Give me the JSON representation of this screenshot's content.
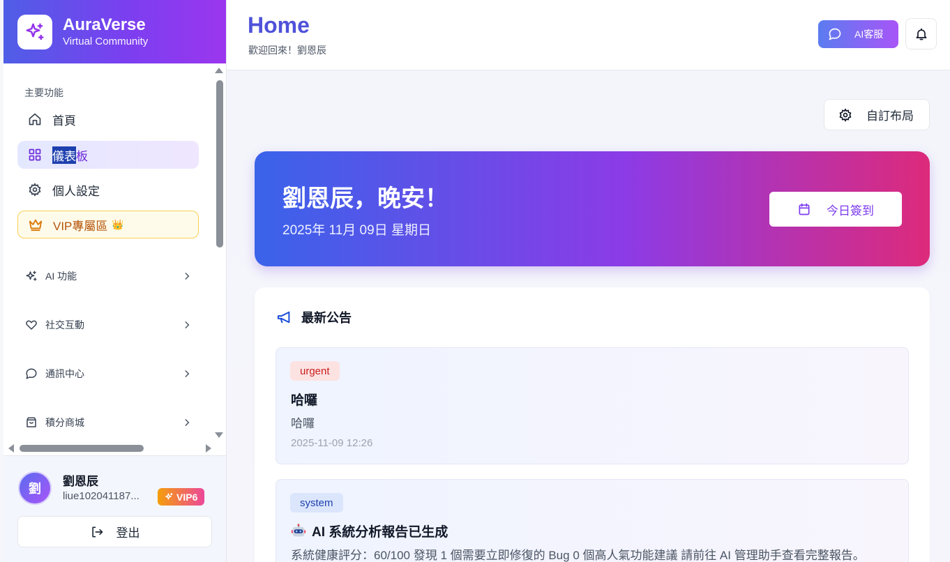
{
  "brand": {
    "name": "AuraVerse",
    "subtitle": "Virtual Community"
  },
  "sidebar": {
    "section_label": "主要功能",
    "items": [
      {
        "label": "首頁",
        "icon": "home-icon"
      },
      {
        "label_selected": "儀表",
        "label_rest": "板",
        "icon": "dashboard-icon",
        "active": true
      },
      {
        "label": "個人設定",
        "icon": "gear-icon"
      },
      {
        "label": "VIP專屬區",
        "icon": "crown-icon",
        "badge": "👑"
      }
    ],
    "groups": [
      {
        "label": "AI 功能",
        "icon": "sparkles-icon"
      },
      {
        "label": "社交互動",
        "icon": "heart-icon"
      },
      {
        "label": "通訊中心",
        "icon": "chat-icon"
      },
      {
        "label": "積分商城",
        "icon": "shopping-bag-icon"
      }
    ]
  },
  "user": {
    "avatar_initial": "劉",
    "name": "劉恩辰",
    "id": "liue102041187...",
    "vip_label": "VIP6",
    "logout_label": "登出"
  },
  "header": {
    "title": "Home",
    "subtitle": "歡迎回來！劉恩辰",
    "ai_service_label": "AI客服"
  },
  "main": {
    "customize_label": "自訂布局",
    "hero": {
      "greeting": "劉恩辰，晚安！",
      "date": "2025年 11月 09日 星期日",
      "checkin_label": "今日簽到"
    },
    "announcements": {
      "title": "最新公告",
      "items": [
        {
          "tag": "urgent",
          "title": "哈囉",
          "body": "哈囉",
          "time": "2025-11-09 12:26"
        },
        {
          "tag": "system",
          "title": "AI 系統分析報告已生成",
          "body": "系統健康評分：60/100 發現 1 個需要立即修復的 Bug 0 個高人氣功能建議 請前往 AI 管理助手查看完整報告。"
        }
      ]
    }
  },
  "colors": {
    "brand_start": "#4f5ee6",
    "brand_end": "#9b36ee",
    "title_accent": "#4f52d9",
    "hero_start": "#3a63ea",
    "hero_end": "#dd2a7b",
    "urgent": "#c81e1e",
    "system": "#1e40af"
  }
}
